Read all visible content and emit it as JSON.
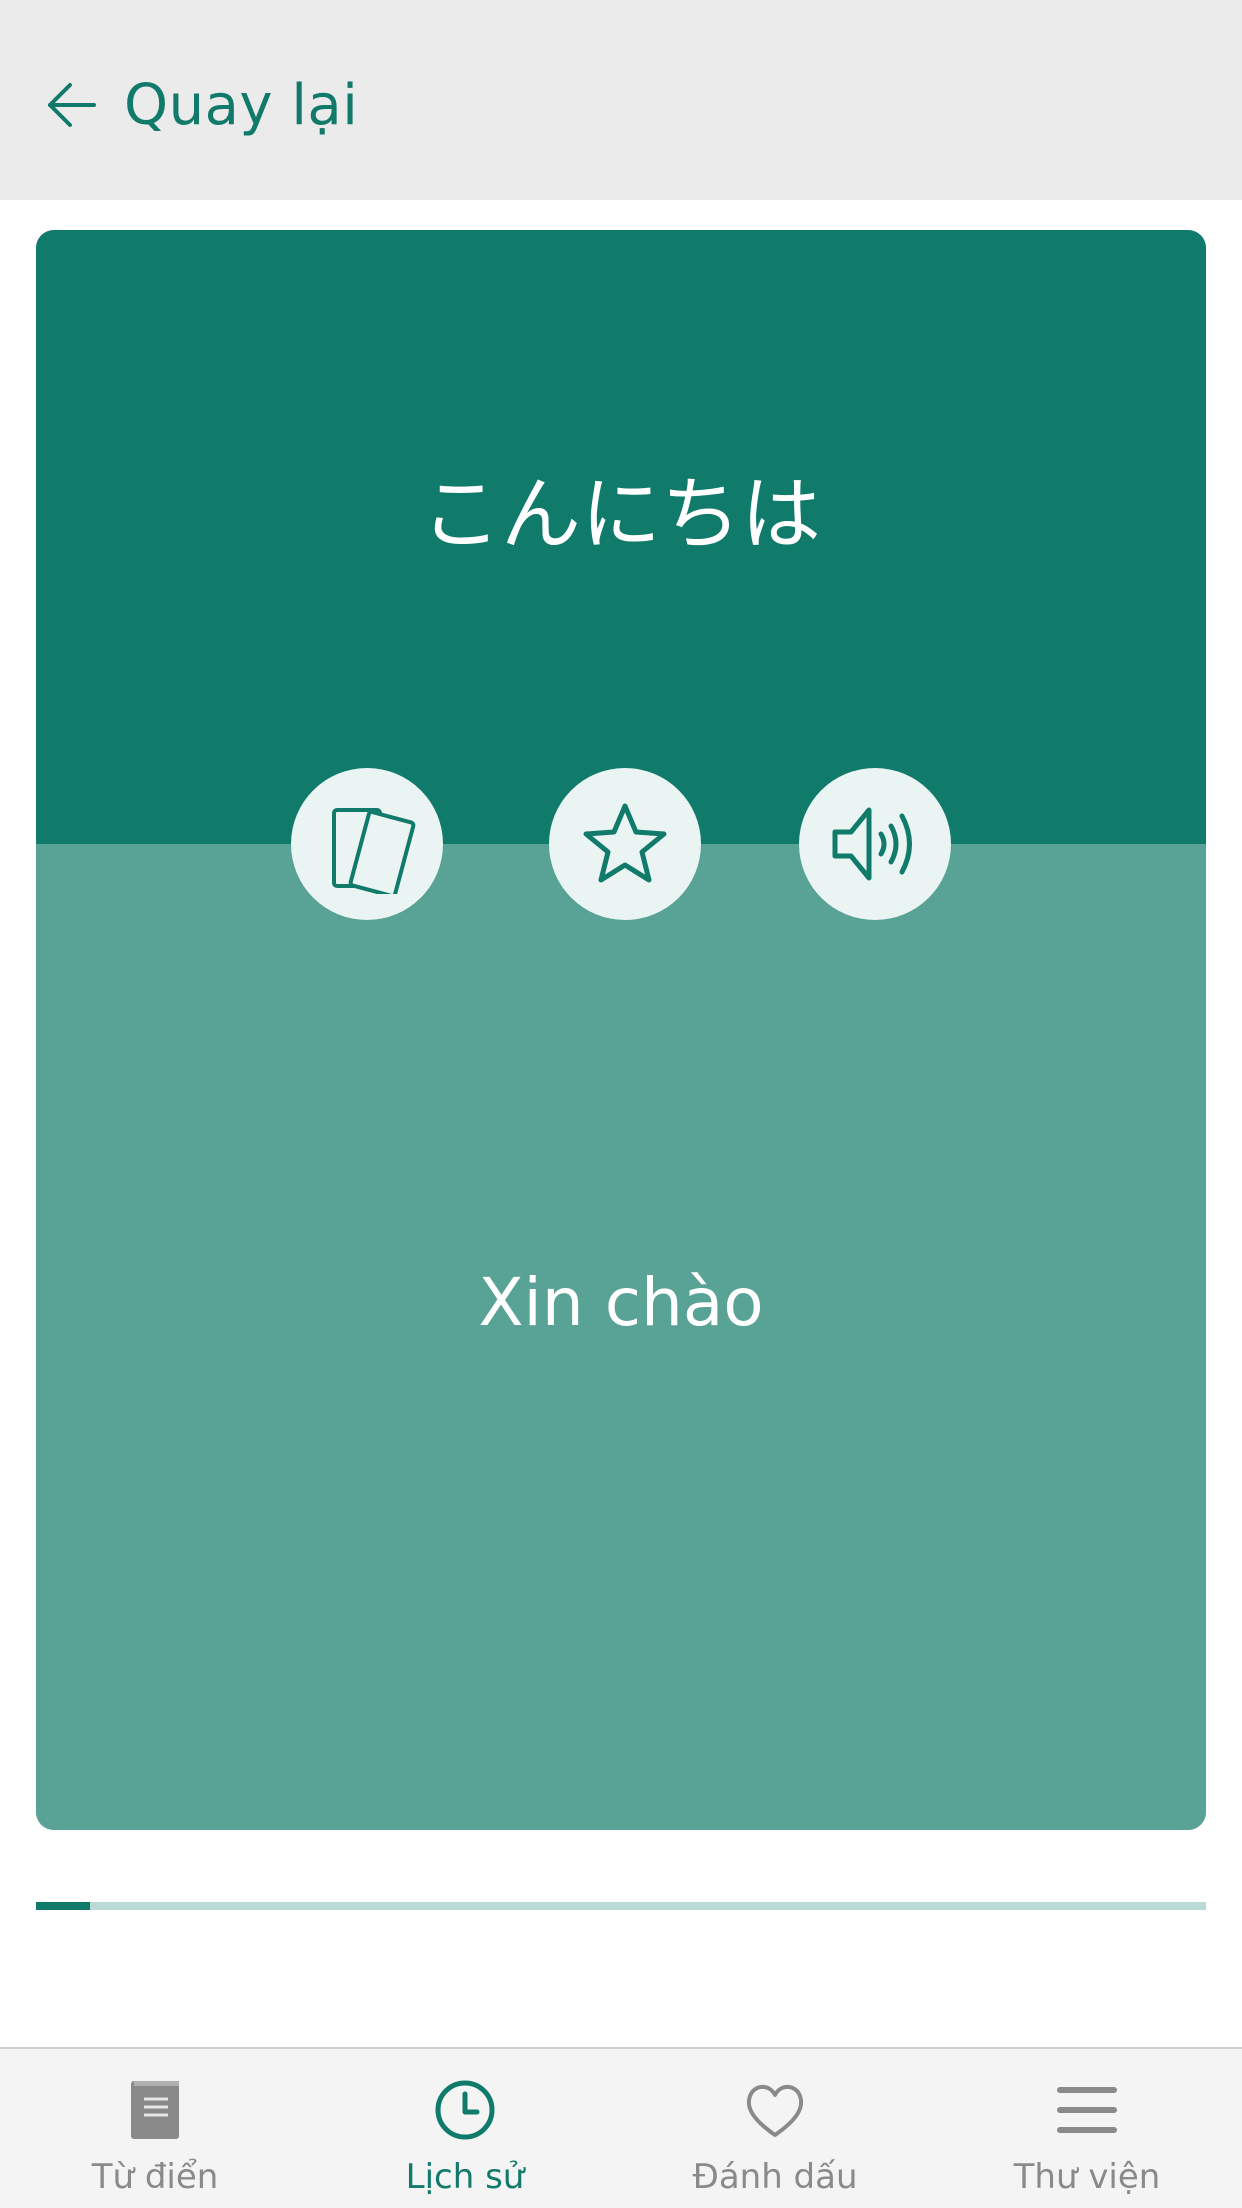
{
  "header": {
    "back_label": "Quay lại"
  },
  "card": {
    "front_text": "こんにちは",
    "back_text": "Xin chào"
  },
  "actions": {
    "flip_icon": "flip-cards-icon",
    "star_icon": "star-icon",
    "sound_icon": "speaker-icon"
  },
  "progress": {
    "fraction": 0.046
  },
  "tabs": [
    {
      "label": "Từ điển",
      "icon": "dictionary-book-icon",
      "active": false
    },
    {
      "label": "Lịch sử",
      "icon": "clock-icon",
      "active": true
    },
    {
      "label": "Đánh dấu",
      "icon": "heart-icon",
      "active": false
    },
    {
      "label": "Thư viện",
      "icon": "menu-lines-icon",
      "active": false
    }
  ],
  "colors": {
    "primary": "#107a6b",
    "card_back": "#58a296",
    "header_bg": "#ebebeb",
    "tab_inactive": "#8a8a8a"
  }
}
